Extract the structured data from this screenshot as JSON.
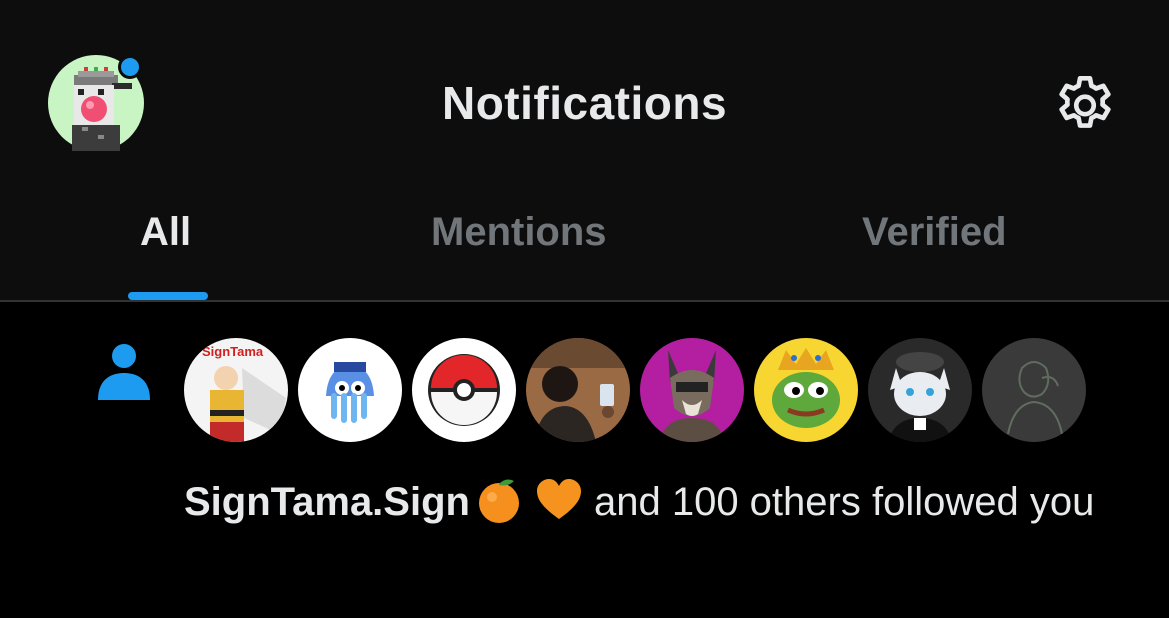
{
  "header": {
    "title": "Notifications",
    "account_avatar_icon": "pixel-art-avatar",
    "has_unread_dot": true,
    "settings_icon": "gear-icon"
  },
  "tabs": [
    {
      "label": "All",
      "active": true
    },
    {
      "label": "Mentions",
      "active": false
    },
    {
      "label": "Verified",
      "active": false
    }
  ],
  "notification": {
    "type_icon": "person-follow-icon",
    "avatars": [
      {
        "name": "signtama-avatar",
        "caption": "SignTama"
      },
      {
        "name": "blue-jellyfish-avatar"
      },
      {
        "name": "pokeball-avatar"
      },
      {
        "name": "man-photo-avatar"
      },
      {
        "name": "wolf-avatar"
      },
      {
        "name": "pepe-king-avatar"
      },
      {
        "name": "cat-avatar"
      },
      {
        "name": "sketch-avatar"
      }
    ],
    "actor_name": "SignTama.Sign",
    "rest_text": "and 100 others followed you"
  },
  "colors": {
    "accent": "#1d9bf0",
    "background": "#000000",
    "header_bg": "#0d0d0d",
    "muted_text": "#71767b",
    "text": "#e7e9ea"
  }
}
